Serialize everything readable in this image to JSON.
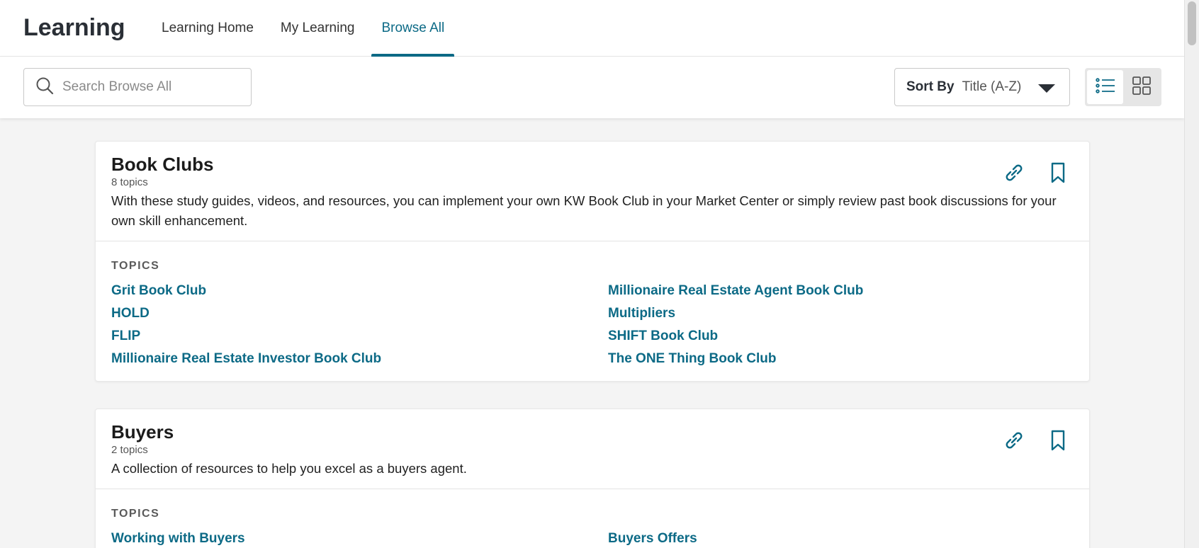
{
  "app": {
    "title": "Learning"
  },
  "nav": {
    "tabs": [
      {
        "label": "Learning Home"
      },
      {
        "label": "My Learning"
      },
      {
        "label": "Browse All"
      }
    ]
  },
  "search": {
    "placeholder": "Search Browse All",
    "value": ""
  },
  "sort": {
    "label": "Sort By",
    "value": "Title (A-Z)"
  },
  "view": {
    "options": [
      "list-view",
      "grid-view"
    ],
    "selected": "list-view"
  },
  "colors": {
    "accent": "#0c6a86",
    "text_dark": "#2a2f36",
    "background": "#f4f4f4"
  },
  "categories": [
    {
      "title": "Book Clubs",
      "count": "8 topics",
      "description": "With these study guides, videos, and resources, you can implement your own KW Book Club in your Market Center or simply review past book discussions for your own skill enhancement.",
      "topics_label": "TOPICS",
      "topics": [
        "Grit Book Club",
        "Millionaire Real Estate Agent Book Club",
        "HOLD",
        "Multipliers",
        "FLIP",
        "SHIFT Book Club",
        "Millionaire Real Estate Investor Book Club",
        "The ONE Thing Book Club"
      ]
    },
    {
      "title": "Buyers",
      "count": "2 topics",
      "description": "A collection of resources to help you excel as a buyers agent.",
      "topics_label": "TOPICS",
      "topics": [
        "Working with Buyers",
        "Buyers Offers"
      ]
    }
  ]
}
